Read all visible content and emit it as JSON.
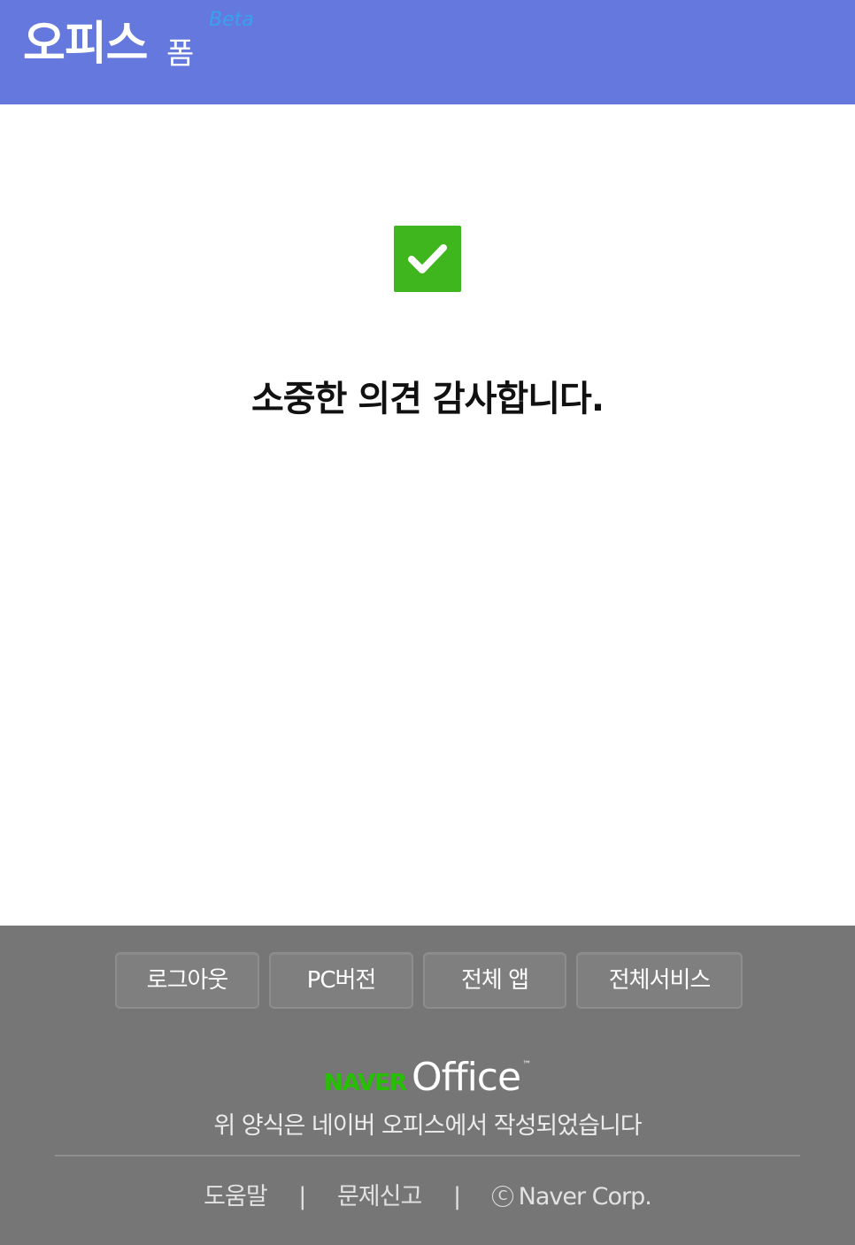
{
  "header": {
    "brand_main": "오피스",
    "brand_sub": "폼",
    "beta": "Beta"
  },
  "main": {
    "check_icon": "checkmark-icon",
    "thanks_message": "소중한 의견 감사합니다."
  },
  "footer": {
    "buttons": {
      "logout": "로그아웃",
      "pc_version": "PC버전",
      "all_apps": "전체 앱",
      "all_services": "전체서비스"
    },
    "logo": {
      "naver": "NAVER",
      "office": "Office",
      "tm": "™"
    },
    "description": "위 양식은 네이버 오피스에서 작성되었습니다",
    "links": {
      "help": "도움말",
      "report": "문제신고",
      "separator": "|",
      "copyright_symbol": "C",
      "copyright": "Naver Corp."
    }
  },
  "colors": {
    "header_bg": "#6478dd",
    "check_bg": "#3fb51e",
    "footer_bg": "#767676",
    "naver_green": "#25c000",
    "beta_blue": "#3aa0f0"
  }
}
